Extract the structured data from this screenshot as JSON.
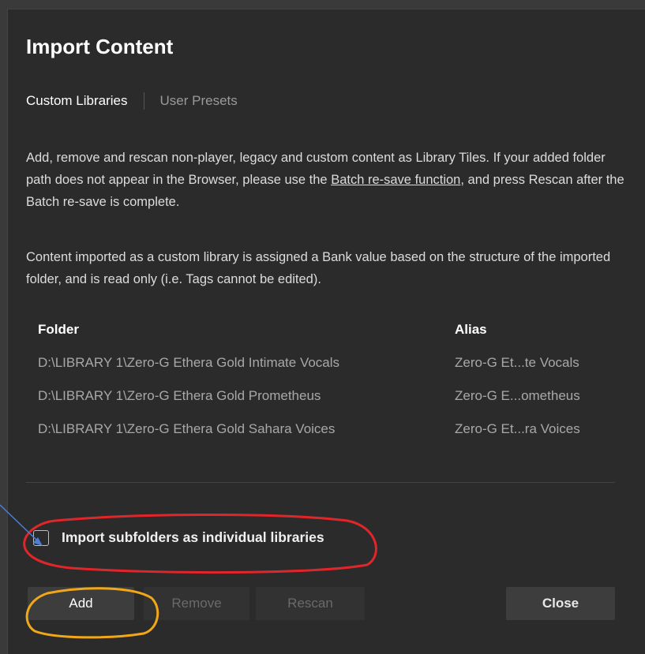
{
  "dialog": {
    "title": "Import Content",
    "tabs": [
      {
        "label": "Custom Libraries",
        "active": true
      },
      {
        "label": "User Presets",
        "active": false
      }
    ],
    "description": {
      "line1_part1": "Add, remove and rescan non-player, legacy and custom content as Library Tiles. If your added folder path does not appear in the Browser, please use the ",
      "link_text": "Batch re-save function",
      "line1_part2": ", and press Rescan after the Batch re-save is complete."
    },
    "note": "Content imported as a custom library is assigned a Bank value based on the structure of the imported folder, and is read only (i.e. Tags cannot be edited).",
    "table": {
      "headers": {
        "folder": "Folder",
        "alias": "Alias"
      },
      "rows": [
        {
          "folder": "D:\\LIBRARY 1\\Zero-G Ethera Gold Intimate Vocals",
          "alias": "Zero-G Et...te Vocals"
        },
        {
          "folder": "D:\\LIBRARY 1\\Zero-G Ethera Gold Prometheus",
          "alias": "Zero-G E...ometheus"
        },
        {
          "folder": "D:\\LIBRARY 1\\Zero-G Ethera Gold Sahara Voices",
          "alias": "Zero-G Et...ra Voices"
        }
      ]
    },
    "checkbox": {
      "label": "Import subfolders as individual libraries",
      "checked": false
    },
    "buttons": {
      "add": "Add",
      "remove": "Remove",
      "rescan": "Rescan",
      "close": "Close"
    }
  },
  "colors": {
    "annotation_red": "#e0262a",
    "annotation_orange": "#f0a818",
    "annotation_arrow": "#4a7fd8"
  }
}
